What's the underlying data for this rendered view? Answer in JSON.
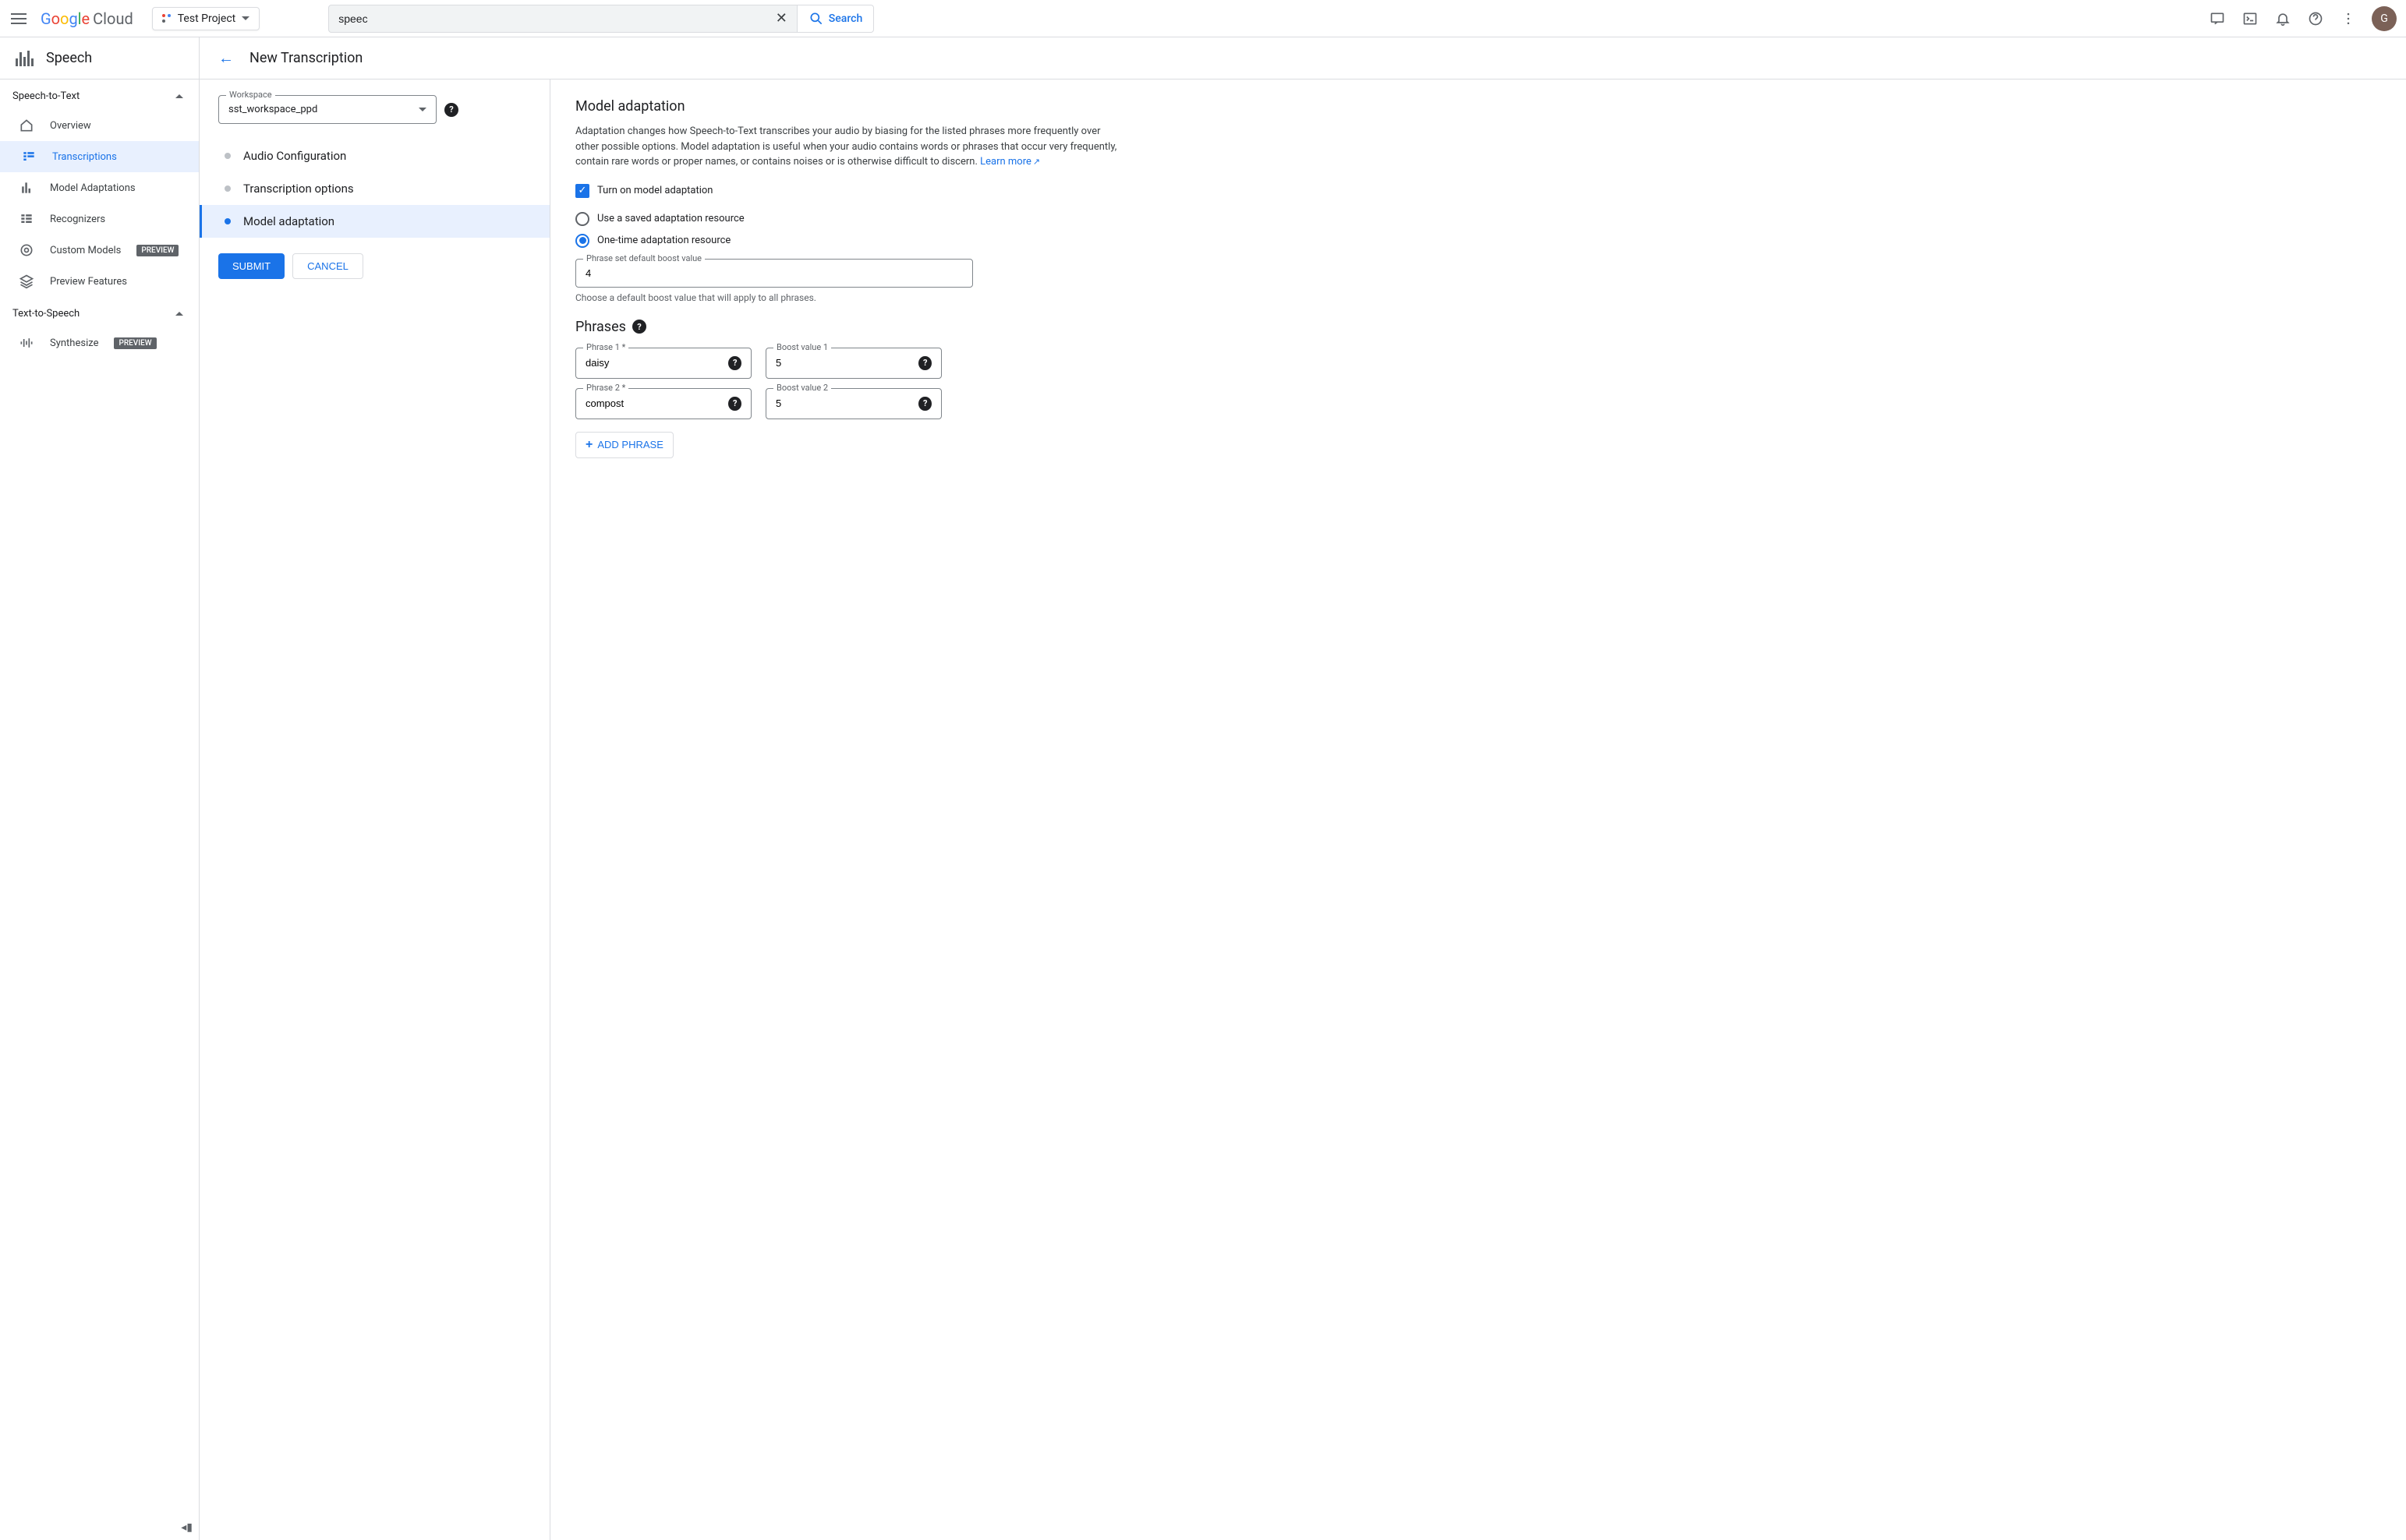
{
  "header": {
    "logo_cloud": "Cloud",
    "project_name": "Test Project",
    "search_value": "speec",
    "search_button": "Search",
    "avatar_letter": "G"
  },
  "sidebar": {
    "title": "Speech",
    "sections": {
      "stt": {
        "label": "Speech-to-Text"
      },
      "tts": {
        "label": "Text-to-Speech"
      }
    },
    "items": {
      "overview": "Overview",
      "transcriptions": "Transcriptions",
      "model_adaptations": "Model Adaptations",
      "recognizers": "Recognizers",
      "custom_models": "Custom Models",
      "preview_features": "Preview Features",
      "synthesize": "Synthesize"
    },
    "preview_badge": "PREVIEW"
  },
  "page": {
    "title": "New Transcription"
  },
  "left": {
    "workspace_label": "Workspace",
    "workspace_value": "sst_workspace_ppd",
    "steps": {
      "audio": "Audio Configuration",
      "trans": "Transcription options",
      "adapt": "Model adaptation"
    },
    "submit": "SUBMIT",
    "cancel": "CANCEL"
  },
  "right": {
    "section_title": "Model adaptation",
    "desc": "Adaptation changes how Speech-to-Text transcribes your audio by biasing for the listed phrases more frequently over other possible options. Model adaptation is useful when your audio contains words or phrases that occur very frequently, contain rare words or proper names, or contains noises or is otherwise difficult to discern. ",
    "learn_more": "Learn more",
    "checkbox_label": "Turn on model adaptation",
    "radio_saved": "Use a saved adaptation resource",
    "radio_onetime": "One-time adaptation resource",
    "boost_label": "Phrase set default boost value",
    "boost_value": "4",
    "boost_helper": "Choose a default boost value that will apply to all phrases.",
    "phrases_title": "Phrases",
    "phrase_rows": [
      {
        "phrase_label": "Phrase 1 *",
        "phrase_value": "daisy",
        "boost_label": "Boost value 1",
        "boost_value": "5"
      },
      {
        "phrase_label": "Phrase 2 *",
        "phrase_value": "compost",
        "boost_label": "Boost value 2",
        "boost_value": "5"
      }
    ],
    "add_phrase": "ADD PHRASE"
  }
}
